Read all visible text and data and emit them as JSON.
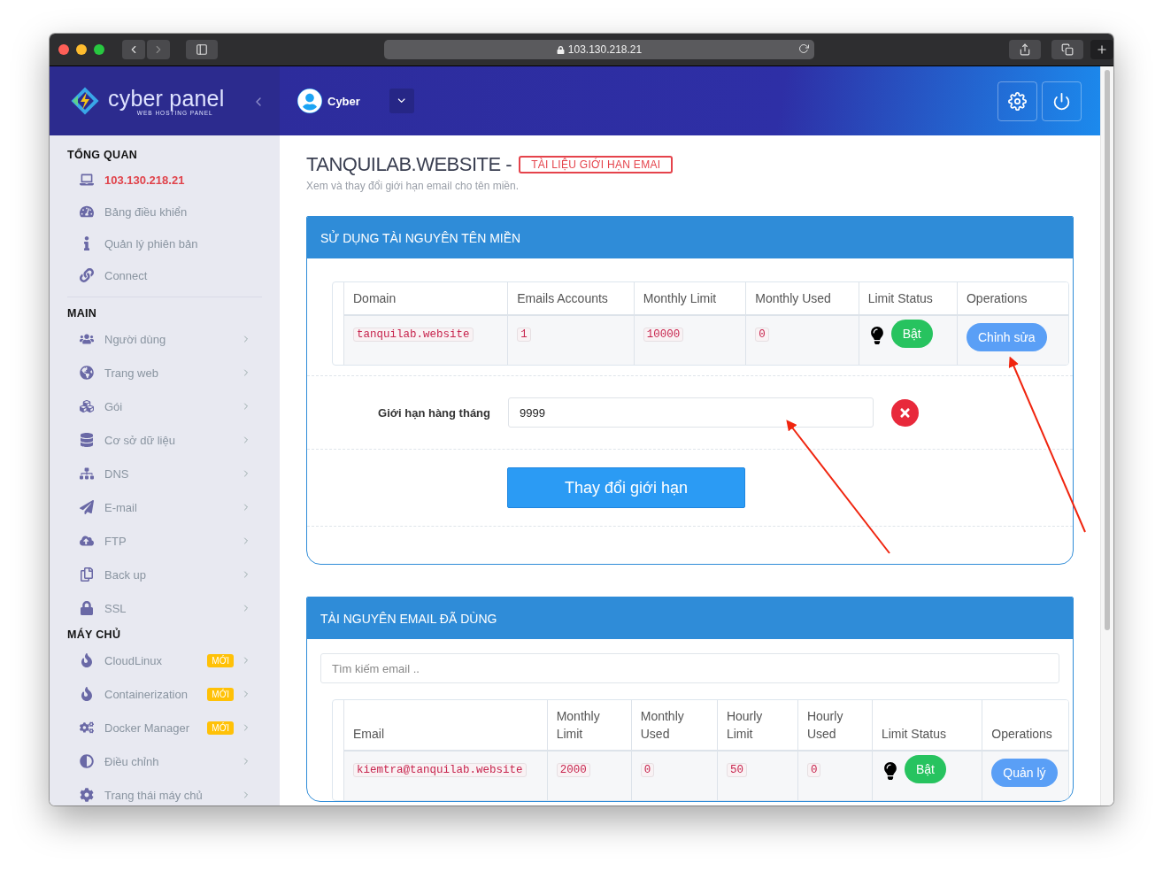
{
  "browser": {
    "url": "103.130.218.21"
  },
  "brand": {
    "name": "cyber panel",
    "tagline": "WEB HOSTING PANEL"
  },
  "topbar": {
    "user": "Cyber"
  },
  "sidebar": {
    "sections": [
      {
        "title": "TỔNG QUAN",
        "items": [
          {
            "label": "103.130.218.21",
            "kind": "server",
            "has_submenu": false
          },
          {
            "label": "Bảng điều khiển",
            "kind": "link",
            "has_submenu": false
          },
          {
            "label": "Quản lý phiên bản",
            "kind": "link",
            "has_submenu": false
          },
          {
            "label": "Connect",
            "kind": "link",
            "has_submenu": false
          }
        ]
      },
      {
        "title": "MAIN",
        "items": [
          {
            "label": "Người dùng",
            "kind": "link",
            "has_submenu": true
          },
          {
            "label": "Trang web",
            "kind": "link",
            "has_submenu": true
          },
          {
            "label": "Gói",
            "kind": "link",
            "has_submenu": true
          },
          {
            "label": "Cơ sở dữ liệu",
            "kind": "link",
            "has_submenu": true
          },
          {
            "label": "DNS",
            "kind": "link",
            "has_submenu": true
          },
          {
            "label": "E-mail",
            "kind": "link",
            "has_submenu": true
          },
          {
            "label": "FTP",
            "kind": "link",
            "has_submenu": true
          },
          {
            "label": "Back up",
            "kind": "link",
            "has_submenu": true
          },
          {
            "label": "SSL",
            "kind": "link",
            "has_submenu": true
          }
        ]
      },
      {
        "title": "MÁY CHỦ",
        "items": [
          {
            "label": "CloudLinux",
            "kind": "link",
            "has_submenu": true,
            "badge": "MỚI"
          },
          {
            "label": "Containerization",
            "kind": "link",
            "has_submenu": true,
            "badge": "MỚI"
          },
          {
            "label": "Docker Manager",
            "kind": "link",
            "has_submenu": true,
            "badge": "MỚI"
          },
          {
            "label": "Điều chỉnh",
            "kind": "link",
            "has_submenu": true
          },
          {
            "label": "Trang thái máy chủ",
            "kind": "link",
            "has_submenu": true
          }
        ]
      }
    ]
  },
  "page": {
    "title": "TANQUILAB.WEBSITE -",
    "doc_link": "TÀI LIỆU GIỚI HẠN EMAI",
    "subtitle": "Xem và thay đổi giới hạn email cho tên miền."
  },
  "domain_panel": {
    "title": "SỬ DỤNG TÀI NGUYÊN TÊN MIỀN",
    "columns": [
      "Domain",
      "Emails Accounts",
      "Monthly Limit",
      "Monthly Used",
      "Limit Status",
      "Operations"
    ],
    "rows": [
      {
        "cells": [
          "tanquilab.website",
          "1",
          "10000",
          "0"
        ],
        "status": "Bật",
        "operation": "Chỉnh sửa"
      }
    ],
    "form": {
      "label": "Giới hạn hàng tháng",
      "value": "9999",
      "submit": "Thay đổi giới hạn"
    }
  },
  "email_panel": {
    "title": "TÀI NGUYÊN EMAIL ĐÃ DÙNG",
    "search": {
      "placeholder": "Tìm kiếm email .."
    },
    "columns": [
      "Email",
      "Monthly Limit",
      "Monthly Used",
      "Hourly Limit",
      "Hourly Used",
      "Limit Status",
      "Operations"
    ],
    "rows": [
      {
        "cells": [
          "kiemtra@tanquilab.website",
          "2000",
          "0",
          "50",
          "0"
        ],
        "status": "Bật",
        "operation": "Quản lý"
      }
    ]
  }
}
